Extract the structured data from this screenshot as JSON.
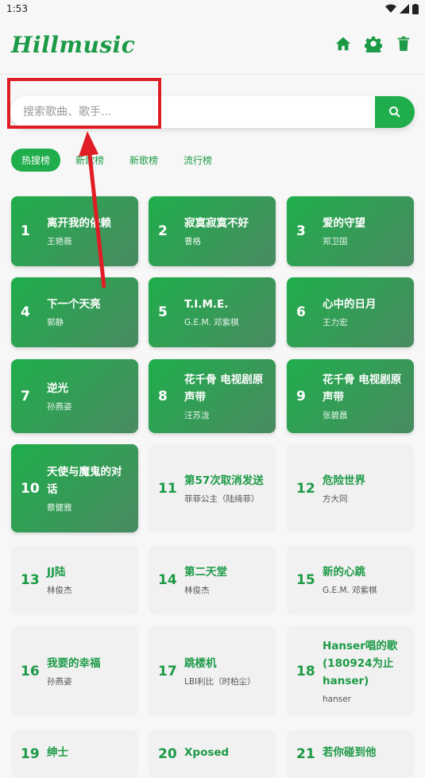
{
  "status": {
    "time": "1:53"
  },
  "app": {
    "logo": "Hillmusic"
  },
  "search": {
    "placeholder": "搜索歌曲、歌手..."
  },
  "tabs": [
    {
      "label": "热搜榜",
      "active": true
    },
    {
      "label": "新歌榜",
      "active": false,
      "partial_hidden": "新歌榜"
    },
    {
      "label": "新歌榜",
      "active": false
    },
    {
      "label": "流行榜",
      "active": false
    }
  ],
  "songs": [
    {
      "rank": "1",
      "title": "离开我的依赖",
      "artist": "王艳薇"
    },
    {
      "rank": "2",
      "title": "寂寞寂寞不好",
      "artist": "曹格"
    },
    {
      "rank": "3",
      "title": "爱的守望",
      "artist": "郑卫国"
    },
    {
      "rank": "4",
      "title": "下一个天亮",
      "artist": "郭静"
    },
    {
      "rank": "5",
      "title": "T.I.M.E.",
      "artist": "G.E.M. 邓紫棋"
    },
    {
      "rank": "6",
      "title": "心中的日月",
      "artist": "王力宏"
    },
    {
      "rank": "7",
      "title": "逆光",
      "artist": "孙燕姿"
    },
    {
      "rank": "8",
      "title": "花千骨 电视剧原声带",
      "artist": "汪苏泷"
    },
    {
      "rank": "9",
      "title": "花千骨 电视剧原声带",
      "artist": "张碧晨"
    },
    {
      "rank": "10",
      "title": "天使与魔鬼的对话",
      "artist": "蔡健雅"
    },
    {
      "rank": "11",
      "title": "第57次取消发送",
      "artist": "菲菲公主（陆绮菲）"
    },
    {
      "rank": "12",
      "title": "危险世界",
      "artist": "方大同"
    },
    {
      "rank": "13",
      "title": "JJ陆",
      "artist": "林俊杰"
    },
    {
      "rank": "14",
      "title": "第二天堂",
      "artist": "林俊杰"
    },
    {
      "rank": "15",
      "title": "新的心跳",
      "artist": "G.E.M. 邓紫棋"
    },
    {
      "rank": "16",
      "title": "我要的幸福",
      "artist": "孙燕姿"
    },
    {
      "rank": "17",
      "title": "跳楼机",
      "artist": "LBI利比（时柏尘）"
    },
    {
      "rank": "18",
      "title": "Hanser唱的歌(180924为止hanser)",
      "artist": "hanser"
    },
    {
      "rank": "19",
      "title": "绅士",
      "artist": ""
    },
    {
      "rank": "20",
      "title": "Xposed",
      "artist": ""
    },
    {
      "rank": "21",
      "title": "若你碰到他",
      "artist": ""
    }
  ],
  "colors": {
    "accent": "#1fae4b",
    "annotation": "#e01d25"
  }
}
